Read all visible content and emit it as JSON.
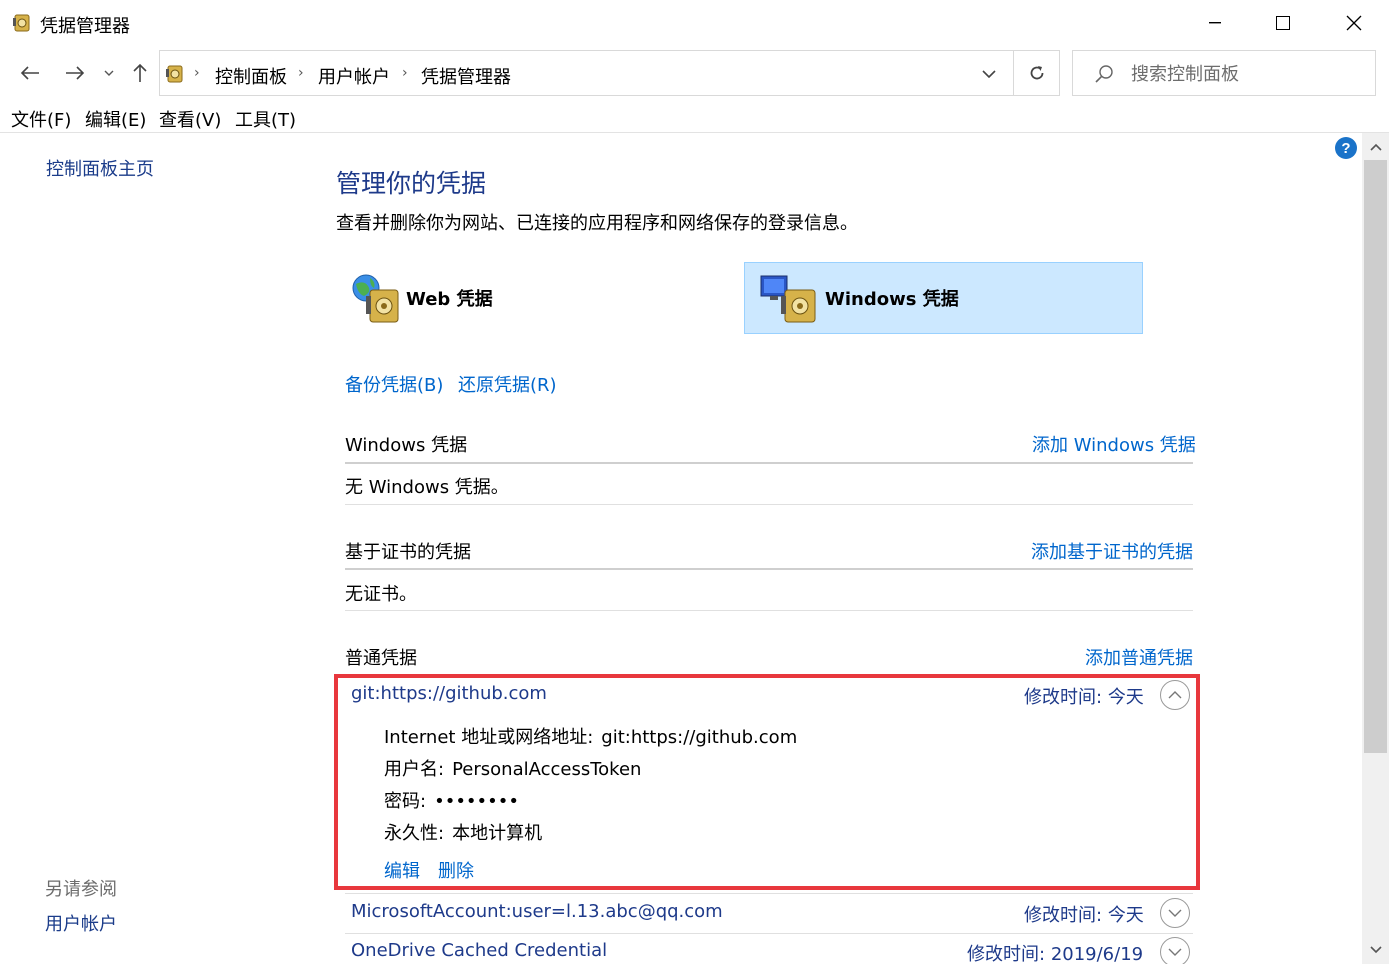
{
  "window": {
    "title": "凭据管理器"
  },
  "address": {
    "crumbs": [
      "控制面板",
      "用户帐户",
      "凭据管理器"
    ],
    "search_placeholder": "搜索控制面板"
  },
  "menu": {
    "items": [
      "文件(F)",
      "编辑(E)",
      "查看(V)",
      "工具(T)"
    ]
  },
  "left_pane": {
    "home_link": "控制面板主页",
    "see_also_title": "另请参阅",
    "see_also_link": "用户帐户"
  },
  "content": {
    "heading": "管理你的凭据",
    "subtitle": "查看并删除你为网站、已连接的应用程序和网络保存的登录信息。",
    "tiles": {
      "web": "Web 凭据",
      "windows": "Windows 凭据"
    },
    "backup_link": "备份凭据(B)",
    "restore_link": "还原凭据(R)",
    "sections": {
      "windows": {
        "title": "Windows 凭据",
        "add": "添加 Windows 凭据",
        "empty": "无 Windows 凭据。"
      },
      "cert": {
        "title": "基于证书的凭据",
        "add": "添加基于证书的凭据",
        "empty": "无证书。"
      },
      "generic": {
        "title": "普通凭据",
        "add": "添加普通凭据"
      }
    },
    "credentials": [
      {
        "name": "git:https://github.com",
        "modified_label": "修改时间:",
        "modified_value": "今天",
        "details": [
          {
            "label": "Internet 地址或网络地址:",
            "value": "git:https://github.com"
          },
          {
            "label": "用户名:",
            "value": "PersonalAccessToken"
          },
          {
            "label": "密码:",
            "value": "••••••••"
          },
          {
            "label": "永久性:",
            "value": "本地计算机"
          }
        ],
        "edit": "编辑",
        "delete": "删除"
      },
      {
        "name": "MicrosoftAccount:user=l.13.abc@qq.com",
        "modified_label": "修改时间:",
        "modified_value": "今天"
      },
      {
        "name": "OneDrive Cached Credential",
        "modified_label": "修改时间:",
        "modified_value": "2019/6/19"
      }
    ]
  },
  "colors": {
    "link": "#0066cc",
    "heading": "#1e3a8a",
    "selected_tile": "#cce8ff",
    "highlight": "#e8373d"
  }
}
